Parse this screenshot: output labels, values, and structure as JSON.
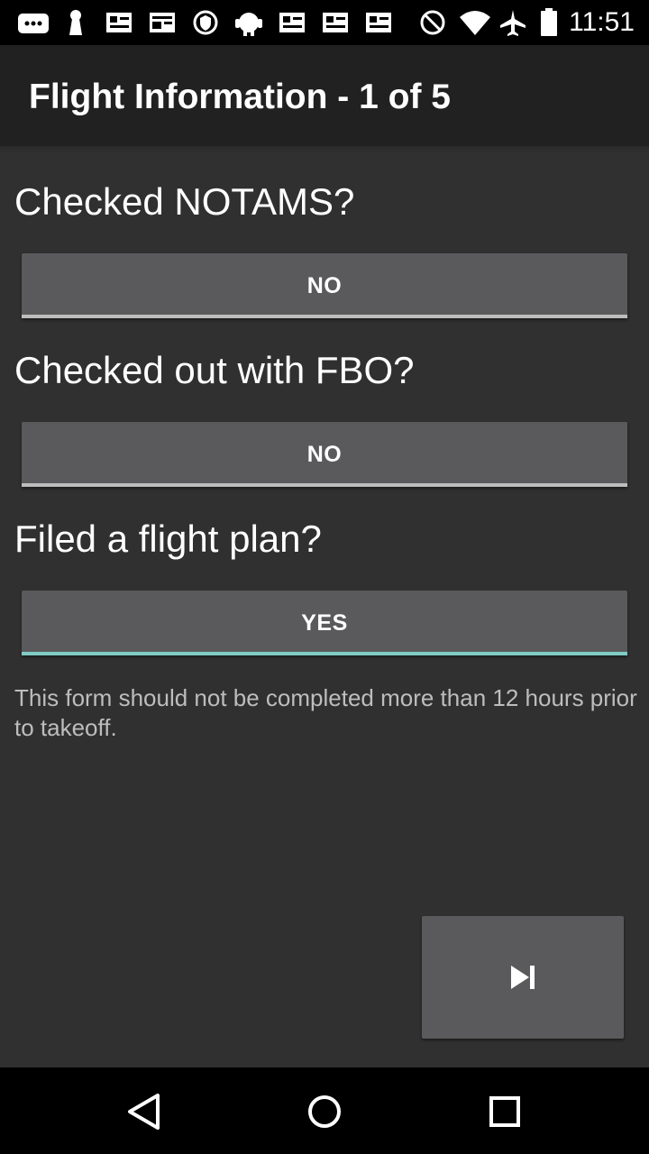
{
  "status_bar": {
    "time": "11:51",
    "icons": [
      "chat-icon",
      "keyhole-icon",
      "news-icon",
      "news-icon",
      "shield-icon",
      "android-icon",
      "news-icon",
      "news-icon",
      "news-icon",
      "block-icon",
      "wifi-icon",
      "airplane-icon",
      "battery-icon"
    ]
  },
  "app_bar": {
    "title": "Flight Information - 1 of 5"
  },
  "form": {
    "questions": [
      {
        "label": "Checked NOTAMS?",
        "value": "NO",
        "checked": false
      },
      {
        "label": "Checked out with FBO?",
        "value": "NO",
        "checked": false
      },
      {
        "label": "Filed a flight plan?",
        "value": "YES",
        "checked": true
      }
    ],
    "note": "This form should not be completed more than 12 hours prior to takeoff."
  },
  "next_button": {
    "icon": "skip-next-icon"
  },
  "nav_bar": {
    "icons": [
      "back-icon",
      "home-icon",
      "recents-icon"
    ]
  },
  "colors": {
    "background": "#303030",
    "app_bar": "#212121",
    "button": "#5a5a5c",
    "toggle_off_bar": "#bdbdbd",
    "toggle_on_bar": "#80cbc4"
  }
}
